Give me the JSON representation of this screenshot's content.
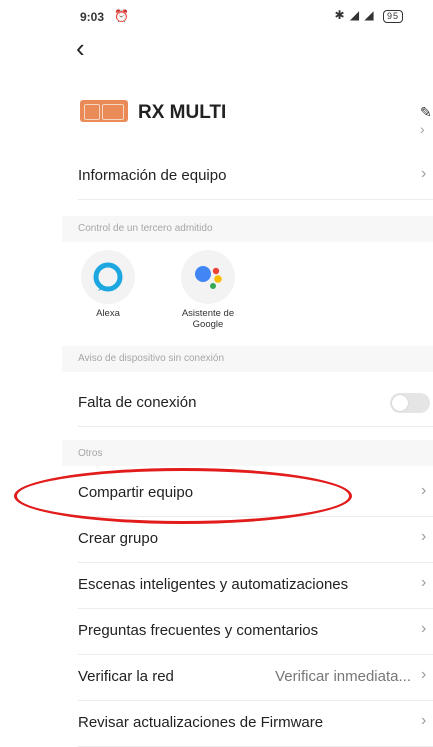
{
  "status_bar": {
    "time": "9:03",
    "alarm_icon": "alarm-clock-icon",
    "signal_text": "✱ ◢ ◢",
    "battery": "95"
  },
  "header": {
    "back_icon": "chevron-left-icon",
    "device_name": "RX MULTI",
    "edit_icon": "pencil-icon"
  },
  "rows": {
    "device_info": "Información de equipo",
    "offline": "Falta de conexión",
    "share": "Compartir equipo",
    "create_group": "Crear grupo",
    "scenes": "Escenas inteligentes y automatizaciones",
    "faq": "Preguntas frecuentes y comentarios",
    "network": "Verificar la red",
    "network_value": "Verificar inmediata...",
    "firmware": "Revisar actualizaciones de Firmware"
  },
  "sections": {
    "third_party": "Control de un tercero admitido",
    "offline_notice": "Aviso de dispositivo sin conexión",
    "others": "Otros"
  },
  "integrations": [
    {
      "label": "Alexa"
    },
    {
      "label": "Asistente de Google"
    }
  ],
  "colors": {
    "highlight": "#e21b1b",
    "device_icon": "#e98a57",
    "alexa": "#1ca7e0"
  },
  "toggles": {
    "offline_enabled": false
  }
}
